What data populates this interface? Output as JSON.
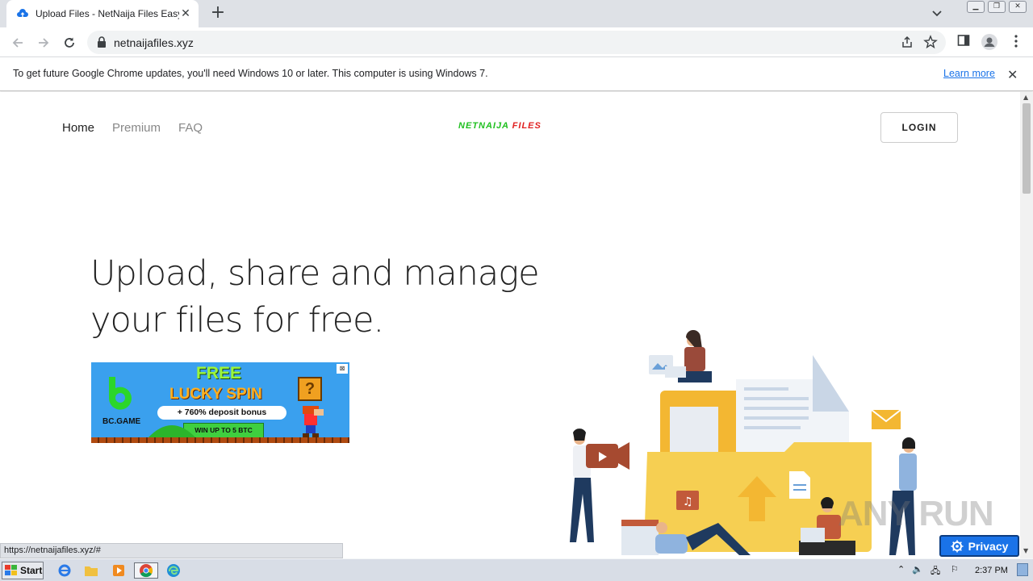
{
  "browser": {
    "tab_title": "Upload Files - NetNaija Files Easy Ac",
    "url": "netnaijafiles.xyz",
    "infobar_message": "To get future Google Chrome updates, you'll need Windows 10 or later. This computer is using Windows 7.",
    "infobar_link": "Learn more",
    "status_url": "https://netnaijafiles.xyz/#"
  },
  "site": {
    "nav": {
      "home": "Home",
      "premium": "Premium",
      "faq": "FAQ"
    },
    "logo_part1": "NETNAIJA",
    "logo_part2": "FILES",
    "login_label": "LOGIN",
    "hero_line1": "Upload, share and manage",
    "hero_line2": "your files for free."
  },
  "ad": {
    "brand": "BC.GAME",
    "headline1": "FREE",
    "headline2": "LUCKY SPIN",
    "bonus": "+ 760% deposit bonus",
    "cta": "WIN UP TO 5 BTC",
    "question": "?"
  },
  "privacy_label": "Privacy",
  "watermark": "ANY RUN",
  "taskbar": {
    "start_label": "Start",
    "clock": "2:37 PM"
  },
  "colors": {
    "logo_green": "#20c020",
    "logo_red": "#e02020",
    "link_blue": "#1a73e8",
    "privacy_blue": "#1a73e8"
  }
}
